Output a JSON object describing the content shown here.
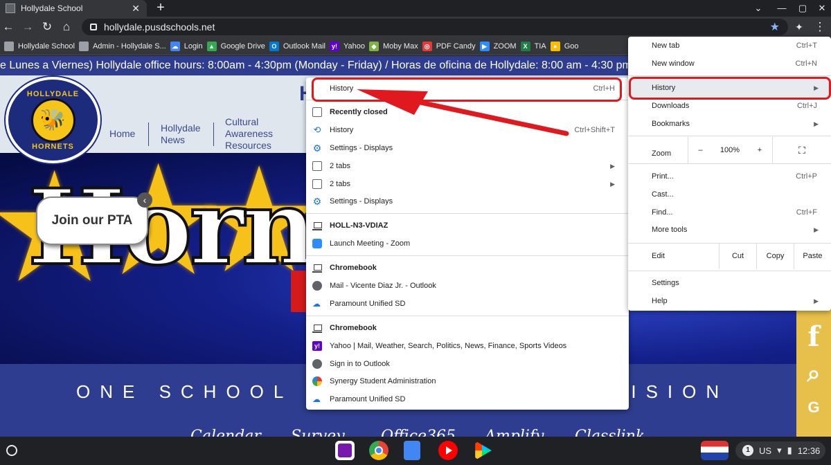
{
  "browser": {
    "tab_title": "Hollydale School",
    "url": "hollydale.pusdschools.net",
    "bookmarks": [
      {
        "label": "Hollydale School",
        "icon": "page-icon",
        "color": "#9aa0a6"
      },
      {
        "label": "Admin - Hollydale S...",
        "icon": "page-icon",
        "color": "#9aa0a6"
      },
      {
        "label": "Login",
        "icon": "cloud-icon",
        "color": "#4285f4"
      },
      {
        "label": "Google Drive",
        "icon": "drive-icon",
        "color": "#34a853"
      },
      {
        "label": "Outlook Mail",
        "icon": "outlook-icon",
        "color": "#0078d4"
      },
      {
        "label": "Yahoo",
        "icon": "yahoo-icon",
        "color": "#6001d2"
      },
      {
        "label": "Moby Max",
        "icon": "mobymax-icon",
        "color": "#7cb342"
      },
      {
        "label": "PDF Candy",
        "icon": "pdfcandy-icon",
        "color": "#e53935"
      },
      {
        "label": "ZOOM",
        "icon": "zoom-icon",
        "color": "#2d8cff"
      },
      {
        "label": "TIA",
        "icon": "excel-icon",
        "color": "#1e7e45"
      },
      {
        "label": "Goo",
        "icon": "meet-icon",
        "color": "#fbbc04"
      }
    ]
  },
  "page": {
    "ticker": "e Lunes a Viernes)   Hollydale office hours: 8:00am - 4:30pm (Monday - Friday)  /  Horas de oficina de Hollydale: 8:00 am - 4:30 pm (de Lu",
    "logo_top": "HOLLYDALE",
    "logo_bottom": "HORNETS",
    "nav": [
      {
        "label": "Home"
      },
      {
        "label": "Hollydale News"
      },
      {
        "label": "Cultural Awareness Resources"
      }
    ],
    "header_letter": "H",
    "hero_word": "Hornet",
    "pta_button": "Join our PTA",
    "motto_left": "ONE SCHOOL",
    "motto_right": "VISION",
    "sublinks": [
      "Calendar",
      "Survey",
      "Office365",
      "Amplify",
      "Classlink"
    ]
  },
  "chrome_menu": {
    "new_tab": "New tab",
    "new_tab_sc": "Ctrl+T",
    "new_window": "New window",
    "new_window_sc": "Ctrl+N",
    "history": "History",
    "downloads": "Downloads",
    "downloads_sc": "Ctrl+J",
    "bookmarks": "Bookmarks",
    "zoom": "Zoom",
    "zoom_minus": "–",
    "zoom_level": "100%",
    "zoom_plus": "+",
    "print": "Print...",
    "print_sc": "Ctrl+P",
    "cast": "Cast...",
    "find": "Find...",
    "find_sc": "Ctrl+F",
    "more_tools": "More tools",
    "edit": "Edit",
    "cut": "Cut",
    "copy": "Copy",
    "paste": "Paste",
    "settings": "Settings",
    "help": "Help"
  },
  "history_menu": {
    "history": "History",
    "history_sc": "Ctrl+H",
    "recently_closed": "Recently closed",
    "items": [
      {
        "label": "History",
        "shortcut": "Ctrl+Shift+T",
        "icon": "history-icon"
      },
      {
        "label": "Settings - Displays",
        "icon": "settings-icon"
      },
      {
        "label": "2 tabs",
        "icon": "tab-icon"
      },
      {
        "label": "2 tabs",
        "icon": "tab-icon"
      },
      {
        "label": "Settings - Displays",
        "icon": "settings-icon"
      }
    ],
    "devices": [
      {
        "name": "HOLL-N3-VDIAZ",
        "items": [
          {
            "label": "Launch Meeting - Zoom",
            "icon": "zoom-icon"
          }
        ]
      },
      {
        "name": "Chromebook",
        "items": [
          {
            "label": "Mail - Vicente Diaz Jr. - Outlook",
            "icon": "globe-icon"
          },
          {
            "label": "Paramount Unified SD",
            "icon": "cloud-icon"
          }
        ]
      },
      {
        "name": "Chromebook",
        "items": [
          {
            "label": "Yahoo | Mail, Weather, Search, Politics, News, Finance, Sports  Videos",
            "icon": "yahoo-icon"
          },
          {
            "label": "Sign in to Outlook",
            "icon": "globe-icon"
          },
          {
            "label": "Synergy Student Administration",
            "icon": "synergy-icon"
          },
          {
            "label": "Paramount Unified SD",
            "icon": "cloud-icon"
          }
        ]
      }
    ]
  },
  "shelf": {
    "notification_count": "1",
    "locale": "US",
    "time": "12:36"
  },
  "colors": {
    "annotation_red": "#e0191e",
    "site_blue": "#2e3d8f",
    "hornet_gold": "#f5c518"
  }
}
